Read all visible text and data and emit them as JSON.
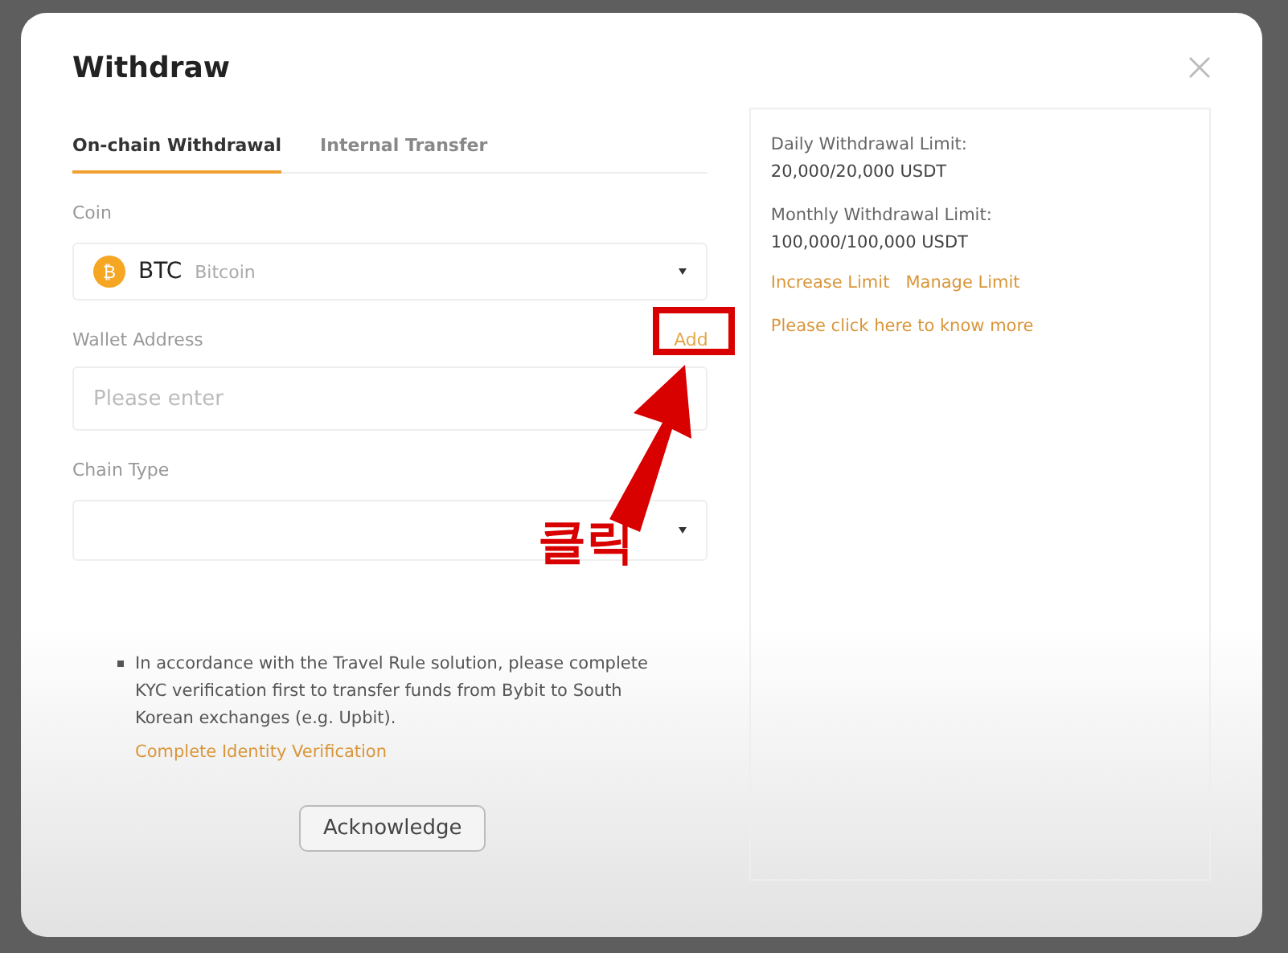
{
  "dialog": {
    "title": "Withdraw"
  },
  "tabs": [
    {
      "label": "On-chain Withdrawal",
      "selected": true
    },
    {
      "label": "Internal Transfer",
      "selected": false
    }
  ],
  "coin": {
    "label": "Coin",
    "symbol": "BTC",
    "name": "Bitcoin",
    "icon_letter": "₿"
  },
  "wallet_address": {
    "label": "Wallet Address",
    "action": "Add",
    "placeholder": "Please enter"
  },
  "chain_type": {
    "label": "Chain Type"
  },
  "notice": {
    "text": "In accordance with the Travel Rule solution, please complete KYC verification first to transfer funds from Bybit to South Korean exchanges (e.g. Upbit).",
    "link": "Complete Identity Verification",
    "button": "Acknowledge"
  },
  "limits": [
    {
      "label": "Daily Withdrawal Limit:",
      "value": "20,000/20,000 USDT"
    },
    {
      "label": "Monthly Withdrawal Limit:",
      "value": "100,000/100,000 USDT"
    }
  ],
  "limit_links": [
    "Increase Limit",
    "Manage Limit"
  ],
  "more_link": "Please click here to know more",
  "annotation": {
    "label": "클릭"
  }
}
